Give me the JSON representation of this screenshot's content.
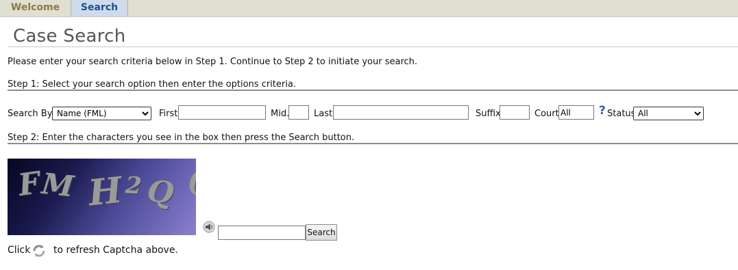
{
  "tabs": [
    {
      "label": "Welcome"
    },
    {
      "label": "Search"
    }
  ],
  "page_title": "Case Search",
  "intro_text": "Please enter your search criteria below in Step 1. Continue to Step 2 to initiate your search.",
  "step1_text": "Step 1: Select your search option then enter the options criteria.",
  "step2_text": "Step 2: Enter the characters you see in the box then press the Search button.",
  "search_form": {
    "search_by_label": "Search By:",
    "search_by_value": "Name (FML)",
    "first_label": "First",
    "first_value": "",
    "mid_label": "Mid.",
    "mid_value": "",
    "last_label": "Last",
    "last_value": "",
    "suffix_label": "Suffix",
    "suffix_value": "",
    "court_label": "Court",
    "court_value": "All",
    "help_glyph": "?",
    "status_label": "Status",
    "status_value": "All"
  },
  "captcha": {
    "glyphs": [
      "F",
      "M",
      "H",
      "2",
      "Q",
      "("
    ],
    "answer_value": "",
    "search_button_label": "Search",
    "speaker_icon": "speaker-icon"
  },
  "refresh": {
    "click_label": "Click",
    "after_text": "to refresh Captcha above.",
    "icon": "refresh-icon"
  }
}
